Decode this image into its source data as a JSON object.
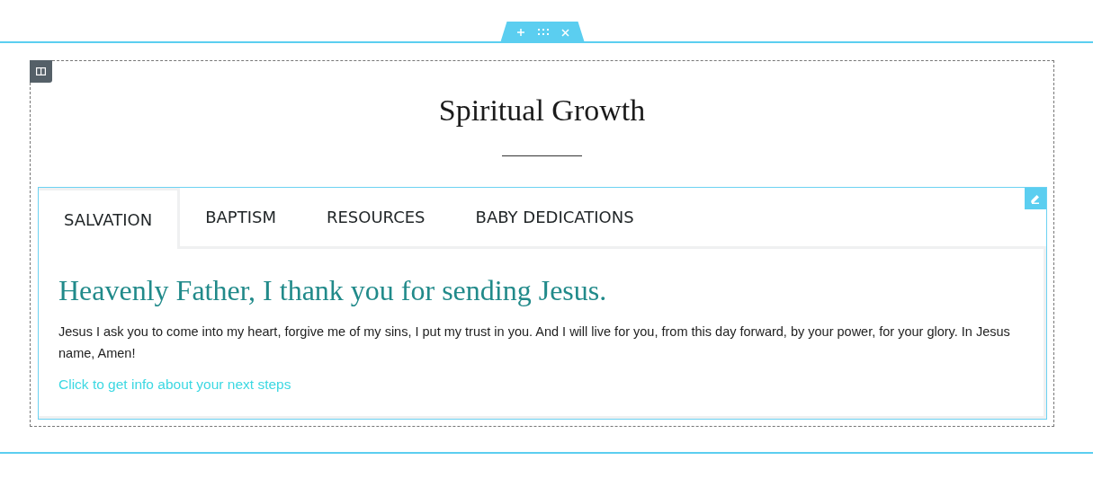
{
  "section_title": "Spiritual Growth",
  "tabs": [
    {
      "label": "SALVATION",
      "selected": true
    },
    {
      "label": "BAPTISM",
      "selected": false
    },
    {
      "label": "RESOURCES",
      "selected": false
    },
    {
      "label": "BABY DEDICATIONS",
      "selected": false
    }
  ],
  "content": {
    "heading": "Heavenly Father, I thank you for sending Jesus.",
    "text": "Jesus I ask you to come into my heart, forgive me of my sins, I put my trust in you. And I will live for you, from this day forward, by your power, for your glory. In Jesus name, Amen!",
    "link": "Click to get info about your next steps"
  }
}
